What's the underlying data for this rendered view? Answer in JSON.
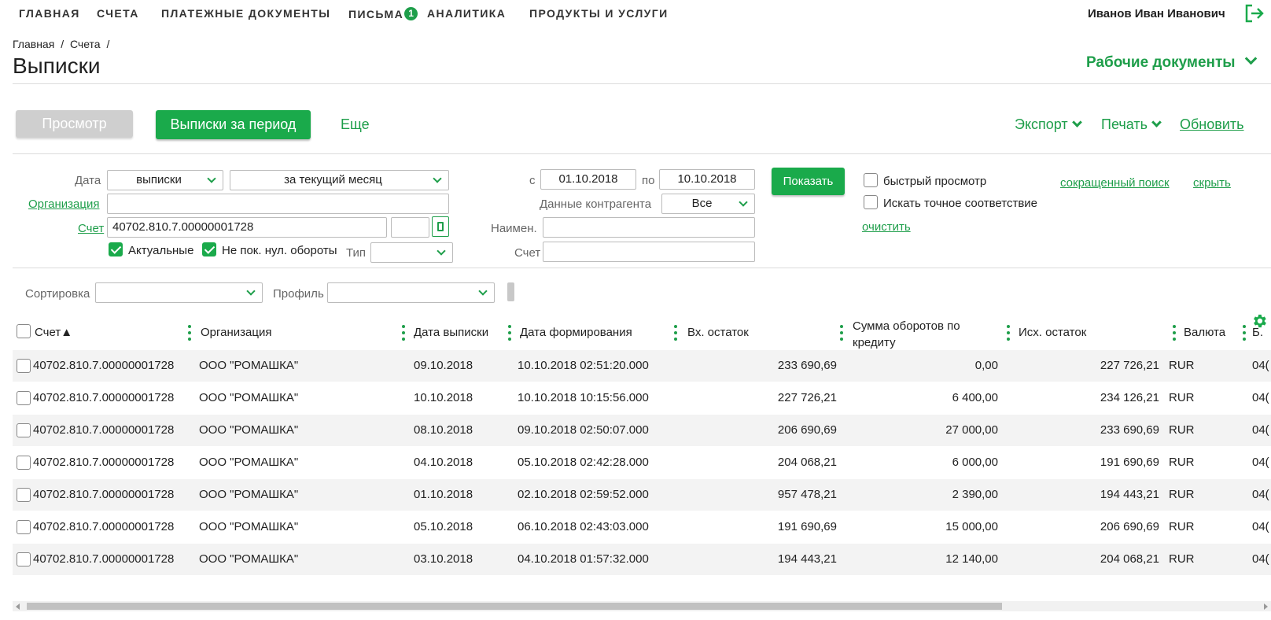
{
  "nav": {
    "items": [
      {
        "label": "ГЛАВНАЯ"
      },
      {
        "label": "СЧЕТА"
      },
      {
        "label": "ПЛАТЕЖНЫЕ ДОКУМЕНТЫ"
      },
      {
        "label": "ПИСЬМА",
        "badge": "1"
      },
      {
        "label": "АНАЛИТИКА"
      },
      {
        "label": "ПРОДУКТЫ И УСЛУГИ"
      }
    ],
    "user_name": "Иванов Иван Иванович",
    "logout_icon": "logout-icon"
  },
  "breadcrumb": [
    "Главная",
    "/",
    "Счета",
    "/"
  ],
  "page_title": "Выписки",
  "work_docs_label": "Рабочие документы",
  "toolbar": {
    "view_label": "Просмотр",
    "period_label": "Выписки за период",
    "more_label": "Еще",
    "export_label": "Экспорт",
    "print_label": "Печать",
    "refresh_label": "Обновить"
  },
  "filter": {
    "date_label": "Дата",
    "date_type": "выписки",
    "date_period": "за текущий месяц",
    "from_label": "с",
    "date_from": "01.10.2018",
    "to_label": "по",
    "date_to": "10.10.2018",
    "show_label": "Показать",
    "org_label": "Организация",
    "org_value": "",
    "account_label": "Счет",
    "account_value": "40702.810.7.00000001728",
    "actual_label": "Актуальные",
    "actual_checked": true,
    "no_zero_label": "Не пок. нул. обороты",
    "no_zero_checked": true,
    "type_label": "Тип",
    "type_value": "",
    "counterparty_label": "Данные контрагента",
    "counterparty_value": "Все",
    "name_label": "Наимен.",
    "name_value": "",
    "cp_account_label": "Счет",
    "cp_account_value": "",
    "quick_view_label": "быстрый просмотр",
    "exact_match_label": "Искать точное соответствие",
    "clear_label": "очистить",
    "short_search_label": "сокращенный поиск",
    "hide_label": "скрыть"
  },
  "sort": {
    "sort_label": "Сортировка",
    "sort_value": "",
    "profile_label": "Профиль",
    "profile_value": ""
  },
  "table": {
    "columns": [
      "Счет▲",
      "Организация",
      "Дата выписки",
      "Дата формирования",
      "Вх. остаток",
      "Сумма оборотов по кредиту",
      "Исх. остаток",
      "Валюта",
      "Б."
    ],
    "rows": [
      [
        "40702.810.7.00000001728",
        "ООО \"РОМАШКА\"",
        "09.10.2018",
        "10.10.2018 02:51:20.000",
        "233 690,69",
        "0,00",
        "227 726,21",
        "RUR",
        "04("
      ],
      [
        "40702.810.7.00000001728",
        "ООО \"РОМАШКА\"",
        "10.10.2018",
        "10.10.2018 10:15:56.000",
        "227 726,21",
        "6 400,00",
        "234 126,21",
        "RUR",
        "04("
      ],
      [
        "40702.810.7.00000001728",
        "ООО \"РОМАШКА\"",
        "08.10.2018",
        "09.10.2018 02:50:07.000",
        "206 690,69",
        "27 000,00",
        "233 690,69",
        "RUR",
        "04("
      ],
      [
        "40702.810.7.00000001728",
        "ООО \"РОМАШКА\"",
        "04.10.2018",
        "05.10.2018 02:42:28.000",
        "204 068,21",
        "6 000,00",
        "191 690,69",
        "RUR",
        "04("
      ],
      [
        "40702.810.7.00000001728",
        "ООО \"РОМАШКА\"",
        "01.10.2018",
        "02.10.2018 02:59:52.000",
        "957 478,21",
        "2 390,00",
        "194 443,21",
        "RUR",
        "04("
      ],
      [
        "40702.810.7.00000001728",
        "ООО \"РОМАШКА\"",
        "05.10.2018",
        "06.10.2018 02:43:03.000",
        "191 690,69",
        "15 000,00",
        "206 690,69",
        "RUR",
        "04("
      ],
      [
        "40702.810.7.00000001728",
        "ООО \"РОМАШКА\"",
        "03.10.2018",
        "04.10.2018 01:57:32.000",
        "194 443,21",
        "12 140,00",
        "204 068,21",
        "RUR",
        "04("
      ]
    ]
  },
  "colors": {
    "accent": "#1aaa4b",
    "link": "#1e9e4a",
    "row_stripe": "#f3f3f3",
    "disabled_button": "#cfcfcf"
  }
}
